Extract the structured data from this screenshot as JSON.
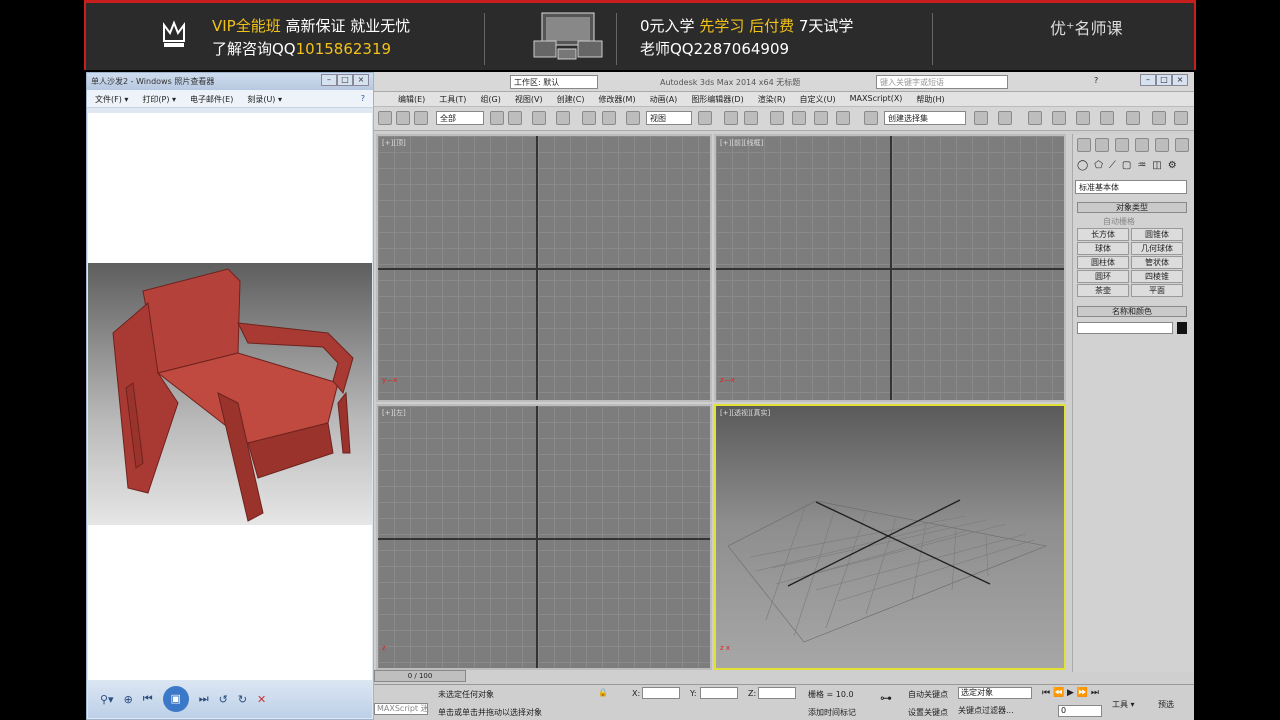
{
  "banner": {
    "line1_a": "VIP全能班",
    "line1_b": "高新保证  就业无忧",
    "line2_a": "了解咨询QQ",
    "line2_b": "1015862319",
    "right1_a": "0元入学",
    "right1_b": "先学习  后付费",
    "right1_c": "7天试学",
    "right2": "老师QQ2287064909",
    "logo": "优⁺名师课"
  },
  "viewer": {
    "title": "单人沙发2 - Windows 照片查看器",
    "menu": [
      "文件(F) ▾",
      "打印(P) ▾",
      "电子邮件(E)",
      "刻录(U) ▾"
    ]
  },
  "max": {
    "workspace": "工作区: 默认",
    "app_title": "Autodesk 3ds Max  2014 x64      无标题",
    "search_placeholder": "键入关键字或短语",
    "menus": [
      "编辑(E)",
      "工具(T)",
      "组(G)",
      "视图(V)",
      "创建(C)",
      "修改器(M)",
      "动画(A)",
      "图形编辑器(D)",
      "渲染(R)",
      "自定义(U)",
      "MAXScript(X)",
      "帮助(H)"
    ],
    "filter": "全部",
    "view": "视图",
    "selset": "创建选择集",
    "vp_labels": [
      "[+][顶]",
      "[+][前][线框]",
      "[+][左]",
      "[+][透视][真实]"
    ],
    "cmd": {
      "category": "标准基本体",
      "rollout_type": "对象类型",
      "autogrid": "自动栅格",
      "objects": [
        "长方体",
        "圆锥体",
        "球体",
        "几何球体",
        "圆柱体",
        "管状体",
        "圆环",
        "四棱锥",
        "茶壶",
        "平面"
      ],
      "rollout_name": "名称和颜色"
    },
    "time": "0 / 100",
    "status1": "未选定任何对象",
    "status2": "单击或单击并拖动以选择对象",
    "maxscript": "MAXScript 迷",
    "x_label": "X:",
    "y_label": "Y:",
    "z_label": "Z:",
    "grid": "栅格 = 10.0",
    "autokey": "自动关键点",
    "setkey": "设置关键点",
    "selobj": "选定对象",
    "keyfilter": "关键点过滤器...",
    "addtag": "添加时间标记",
    "frame": "0",
    "tools": "工具 ▾",
    "preset": "预选"
  }
}
